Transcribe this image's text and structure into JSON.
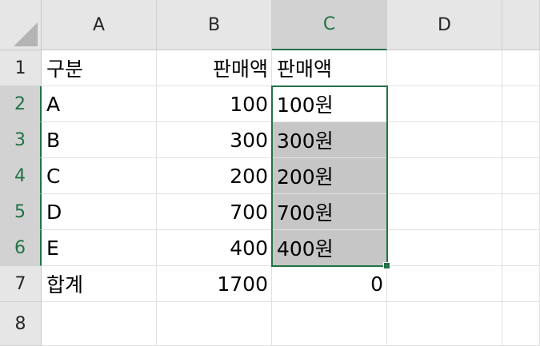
{
  "columns": [
    "A",
    "B",
    "C",
    "D",
    ""
  ],
  "rows": [
    "1",
    "2",
    "3",
    "4",
    "5",
    "6",
    "7",
    "8"
  ],
  "cells": {
    "A1": "구분",
    "B1": "판매액",
    "C1": "판매액",
    "A2": "A",
    "B2": "100",
    "C2": "100원",
    "A3": "B",
    "B3": "300",
    "C3": "300원",
    "A4": "C",
    "B4": "200",
    "C4": "200원",
    "A5": "D",
    "B5": "700",
    "C5": "700원",
    "A6": "E",
    "B6": "400",
    "C6": "400원",
    "A7": "합계",
    "B7": "1700",
    "C7": "0"
  },
  "selection": {
    "range": "C2:C6",
    "active_cell": "C2"
  },
  "colors": {
    "accent": "#217346",
    "header_bg": "#e6e6e6",
    "header_selected_bg": "#d2d2d2",
    "selected_cell_bg": "#c6c6c6",
    "gridline": "#e1e1e1"
  }
}
